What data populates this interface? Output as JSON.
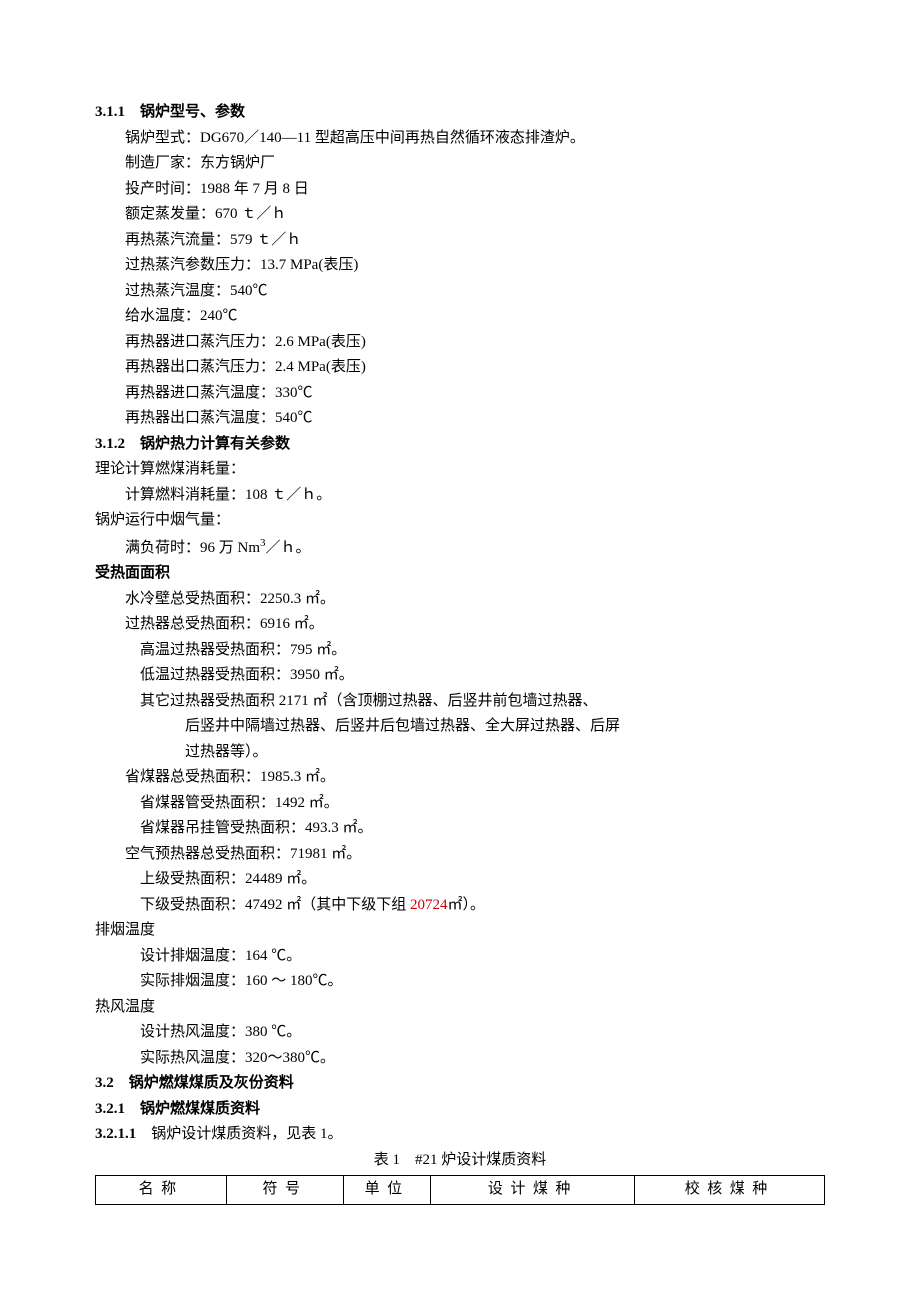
{
  "s311": {
    "heading": "3.1.1　锅炉型号、参数",
    "lines": [
      "锅炉型式：DG670／140—11 型超高压中间再热自然循环液态排渣炉。",
      "制造厂家：东方锅炉厂",
      "投产时间：1988 年 7 月 8 日",
      "额定蒸发量：670 ｔ／ｈ",
      "再热蒸汽流量：579 ｔ／ｈ",
      "过热蒸汽参数压力：13.7 MPa(表压)",
      "过热蒸汽温度：540℃",
      "给水温度：240℃",
      "再热器进口蒸汽压力：2.6 MPa(表压)",
      "再热器出口蒸汽压力：2.4 MPa(表压)",
      "再热器进口蒸汽温度：330℃",
      "再热器出口蒸汽温度：540℃"
    ]
  },
  "s312": {
    "heading": "3.1.2　锅炉热力计算有关参数",
    "lead1": "理论计算燃煤消耗量：",
    "line1": "计算燃料消耗量：108 ｔ／ｈ。",
    "lead2": "锅炉运行中烟气量：",
    "line2_pre": "满负荷时：96 万 Nm",
    "line2_sup": "3",
    "line2_post": "／ｈ。"
  },
  "heat_area": {
    "heading": "受热面面积",
    "lines_p1": [
      "水冷壁总受热面积：2250.3 ㎡。",
      "过热器总受热面积：6916 ㎡。"
    ],
    "lines_p2a": [
      "高温过热器受热面积：795 ㎡。",
      "低温过热器受热面积：3950 ㎡。",
      "其它过热器受热面积 2171 ㎡（含顶棚过热器、后竖井前包墙过热器、"
    ],
    "lines_p4": [
      "后竖井中隔墙过热器、后竖井后包墙过热器、全大屏过热器、后屏",
      "过热器等）。"
    ],
    "lines_p1b": "省煤器总受热面积：1985.3 ㎡。",
    "lines_p2b": [
      "省煤器管受热面积：1492 ㎡。",
      "省煤器吊挂管受热面积：493.3 ㎡。"
    ],
    "lines_p1c": "空气预热器总受热面积：71981 ㎡。",
    "lines_p2c_1": "上级受热面积：24489 ㎡。",
    "lines_p2c_2_pre": "下级受热面积：47492 ㎡（其中下级下组 ",
    "lines_p2c_2_red": "20724",
    "lines_p2c_2_post": "㎡）。"
  },
  "exhaust": {
    "heading": "排烟温度",
    "lines": [
      "设计排烟温度：164 ℃。",
      "实际排烟温度：160 ～ 180℃。"
    ]
  },
  "hotair": {
    "heading": "热风温度",
    "lines": [
      "设计热风温度：380 ℃。",
      "实际热风温度：320～380℃。"
    ]
  },
  "s32": "3.2　锅炉燃煤煤质及灰份资料",
  "s321": "3.2.1　锅炉燃煤煤质资料",
  "s3211_num": "3.2.1.1",
  "s3211_txt": "　锅炉设计煤质资料，见表 1。",
  "table_title": "表 1　#21 炉设计煤质资料",
  "table_headers": [
    "名称",
    "符号",
    "单位",
    "设计煤种",
    "校核煤种"
  ]
}
